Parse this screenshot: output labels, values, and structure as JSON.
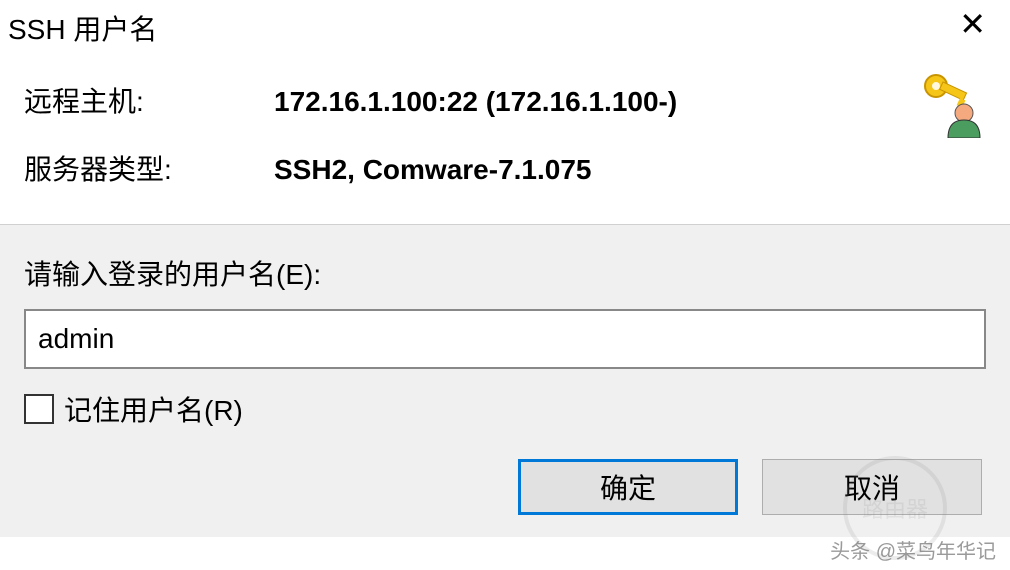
{
  "titlebar": {
    "title": "SSH 用户名"
  },
  "info": {
    "remote_host_label": "远程主机:",
    "remote_host_value": "172.16.1.100:22 (172.16.1.100-)",
    "server_type_label": "服务器类型:",
    "server_type_value": "SSH2, Comware-7.1.075"
  },
  "form": {
    "username_prompt": "请输入登录的用户名(E):",
    "username_value": "admin",
    "remember_label": "记住用户名(R)",
    "remember_checked": false
  },
  "buttons": {
    "ok": "确定",
    "cancel": "取消"
  },
  "watermark": {
    "text_left": "头条",
    "text_right": "@菜鸟年华记",
    "text_badge": "路由器"
  }
}
